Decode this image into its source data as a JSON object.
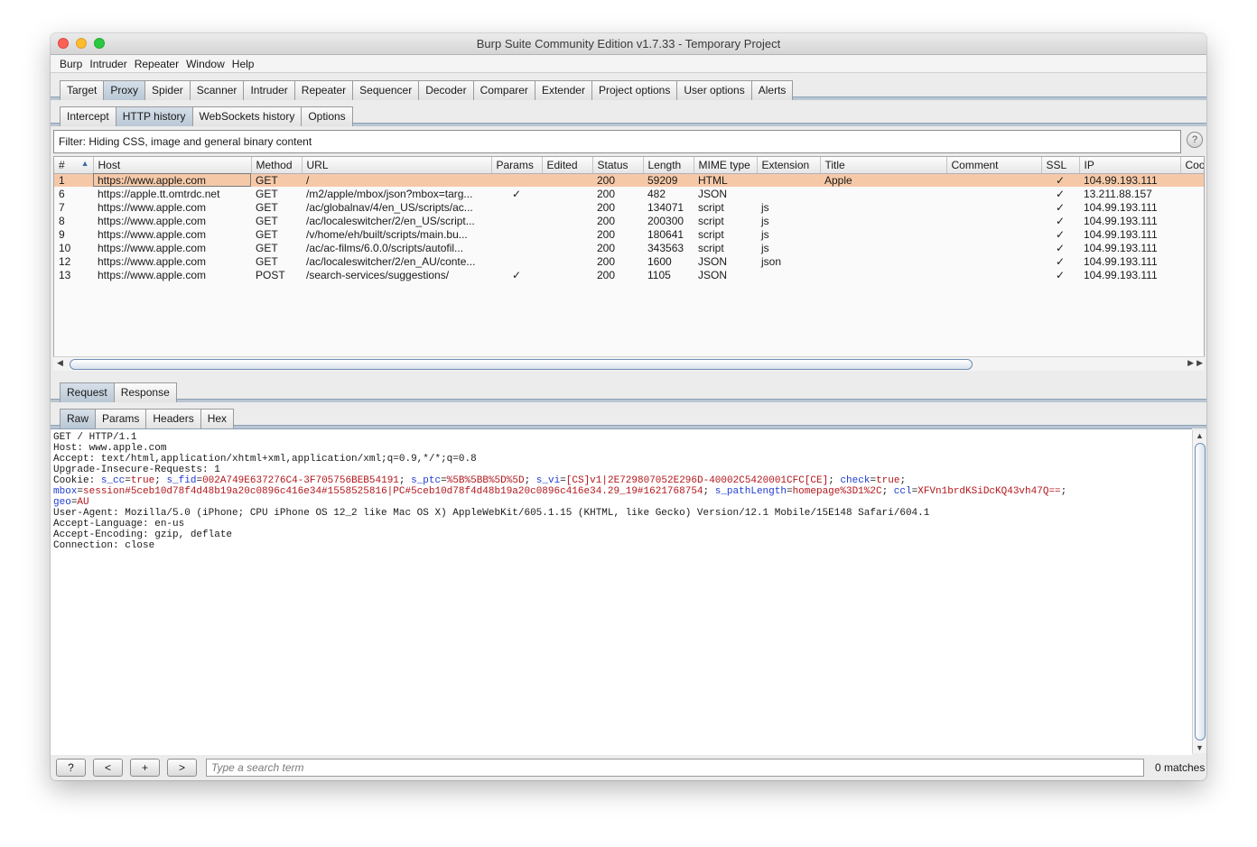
{
  "window": {
    "title": "Burp Suite Community Edition v1.7.33 - Temporary Project"
  },
  "menu": [
    "Burp",
    "Intruder",
    "Repeater",
    "Window",
    "Help"
  ],
  "main_tabs": [
    "Target",
    "Proxy",
    "Spider",
    "Scanner",
    "Intruder",
    "Repeater",
    "Sequencer",
    "Decoder",
    "Comparer",
    "Extender",
    "Project options",
    "User options",
    "Alerts"
  ],
  "active_main_tab": "Proxy",
  "proxy_tabs": [
    "Intercept",
    "HTTP history",
    "WebSockets history",
    "Options"
  ],
  "active_proxy_tab": "HTTP history",
  "filter": {
    "text": "Filter: Hiding CSS, image and general binary content",
    "help": "?"
  },
  "table": {
    "sort_indicator": "▲",
    "columns": [
      "#",
      "Host",
      "Method",
      "URL",
      "Params",
      "Edited",
      "Status",
      "Length",
      "MIME type",
      "Extension",
      "Title",
      "Comment",
      "SSL",
      "IP",
      "Coo"
    ],
    "rows": [
      {
        "num": "1",
        "host": "https://www.apple.com",
        "method": "GET",
        "url": "/",
        "params": "",
        "edited": "",
        "status": "200",
        "length": "59209",
        "mime": "HTML",
        "ext": "",
        "title": "Apple",
        "comment": "",
        "ssl": "✓",
        "ip": "104.99.193.111",
        "coo": ""
      },
      {
        "num": "6",
        "host": "https://apple.tt.omtrdc.net",
        "method": "GET",
        "url": "/m2/apple/mbox/json?mbox=targ...",
        "params": "✓",
        "edited": "",
        "status": "200",
        "length": "482",
        "mime": "JSON",
        "ext": "",
        "title": "",
        "comment": "",
        "ssl": "✓",
        "ip": "13.211.88.157",
        "coo": ""
      },
      {
        "num": "7",
        "host": "https://www.apple.com",
        "method": "GET",
        "url": "/ac/globalnav/4/en_US/scripts/ac...",
        "params": "",
        "edited": "",
        "status": "200",
        "length": "134071",
        "mime": "script",
        "ext": "js",
        "title": "",
        "comment": "",
        "ssl": "✓",
        "ip": "104.99.193.111",
        "coo": ""
      },
      {
        "num": "8",
        "host": "https://www.apple.com",
        "method": "GET",
        "url": "/ac/localeswitcher/2/en_US/script...",
        "params": "",
        "edited": "",
        "status": "200",
        "length": "200300",
        "mime": "script",
        "ext": "js",
        "title": "",
        "comment": "",
        "ssl": "✓",
        "ip": "104.99.193.111",
        "coo": ""
      },
      {
        "num": "9",
        "host": "https://www.apple.com",
        "method": "GET",
        "url": "/v/home/eh/built/scripts/main.bu...",
        "params": "",
        "edited": "",
        "status": "200",
        "length": "180641",
        "mime": "script",
        "ext": "js",
        "title": "",
        "comment": "",
        "ssl": "✓",
        "ip": "104.99.193.111",
        "coo": ""
      },
      {
        "num": "10",
        "host": "https://www.apple.com",
        "method": "GET",
        "url": "/ac/ac-films/6.0.0/scripts/autofil...",
        "params": "",
        "edited": "",
        "status": "200",
        "length": "343563",
        "mime": "script",
        "ext": "js",
        "title": "",
        "comment": "",
        "ssl": "✓",
        "ip": "104.99.193.111",
        "coo": ""
      },
      {
        "num": "12",
        "host": "https://www.apple.com",
        "method": "GET",
        "url": "/ac/localeswitcher/2/en_AU/conte...",
        "params": "",
        "edited": "",
        "status": "200",
        "length": "1600",
        "mime": "JSON",
        "ext": "json",
        "title": "",
        "comment": "",
        "ssl": "✓",
        "ip": "104.99.193.111",
        "coo": ""
      },
      {
        "num": "13",
        "host": "https://www.apple.com",
        "method": "POST",
        "url": "/search-services/suggestions/",
        "params": "✓",
        "edited": "",
        "status": "200",
        "length": "1105",
        "mime": "JSON",
        "ext": "",
        "title": "",
        "comment": "",
        "ssl": "✓",
        "ip": "104.99.193.111",
        "coo": ""
      }
    ]
  },
  "message_tabs": [
    "Request",
    "Response"
  ],
  "active_message_tab": "Request",
  "view_tabs": [
    "Raw",
    "Params",
    "Headers",
    "Hex"
  ],
  "active_view_tab": "Raw",
  "request": {
    "lines": [
      "GET / HTTP/1.1",
      "Host: www.apple.com",
      "Accept: text/html,application/xhtml+xml,application/xml;q=0.9,*/*;q=0.8",
      "Upgrade-Insecure-Requests: 1"
    ],
    "cookie_label": "Cookie: ",
    "cookies_line1": [
      {
        "k": "s_cc",
        "v": "true"
      },
      {
        "k": "s_fid",
        "v": "002A749E637276C4-3F705756BEB54191"
      },
      {
        "k": "s_ptc",
        "v": "%5B%5BB%5D%5D"
      },
      {
        "k": "s_vi",
        "v": "[CS]v1|2E729807052E296D-40002C5420001CFC[CE]"
      },
      {
        "k": "check",
        "v": "true"
      }
    ],
    "cookies_line2": [
      {
        "k": "mbox",
        "v": "session#5ceb10d78f4d48b19a20c0896c416e34#1558525816|PC#5ceb10d78f4d48b19a20c0896c416e34.29_19#1621768754"
      },
      {
        "k": "s_pathLength",
        "v": "homepage%3D1%2C"
      },
      {
        "k": "ccl",
        "v": "XFVn1brdKSiDcKQ43vh47Q=="
      }
    ],
    "cookies_line3": [
      {
        "k": "geo",
        "v": "AU"
      }
    ],
    "lines_after": [
      "User-Agent: Mozilla/5.0 (iPhone; CPU iPhone OS 12_2 like Mac OS X) AppleWebKit/605.1.15 (KHTML, like Gecko) Version/12.1 Mobile/15E148 Safari/604.1",
      "Accept-Language: en-us",
      "Accept-Encoding: gzip, deflate",
      "Connection: close"
    ]
  },
  "bottom": {
    "help": "?",
    "prev": "<",
    "add": "+",
    "next": ">",
    "search_placeholder": "Type a search term",
    "matches": "0 matches"
  },
  "colors": {
    "selected_row": "#f5c9a8",
    "cookie_key": "#1f3cd4",
    "cookie_value": "#b3171c",
    "active_tab": "#c6d2de"
  }
}
